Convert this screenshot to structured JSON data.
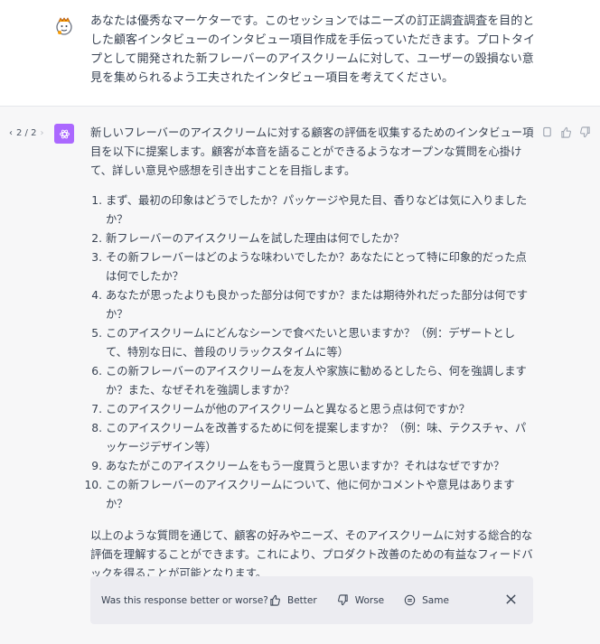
{
  "user_message": {
    "text": "あなたは優秀なマーケターです。このセッションではニーズの訂正調査調査を目的とした顧客インタビューのインタビュー項目作成を手伝っていただきます。プロトタイプとして開発された新フレーバーのアイスクリームに対して、ユーザーの毀損ない意見を集められるよう工夫されたインタビュー項目を考えてください。"
  },
  "assistant_message": {
    "pager": {
      "prev_icon": "chevron-left",
      "label": "2 / 2",
      "next_icon": "chevron-right"
    },
    "intro": "新しいフレーバーのアイスクリームに対する顧客の評価を収集するためのインタビュー項目を以下に提案します。顧客が本音を語ることができるようなオープンな質問を心掛けて、詳しい意見や感想を引き出すことを目指します。",
    "items": [
      "まず、最初の印象はどうでしたか？パッケージや見た目、香りなどは気に入りましたか？",
      "新フレーバーのアイスクリームを試した理由は何でしたか？",
      "その新フレーバーはどのような味わいでしたか？あなたにとって特に印象的だった点は何でしたか？",
      "あなたが思ったよりも良かった部分は何ですか？または期待外れだった部分は何ですか？",
      "このアイスクリームにどんなシーンで食べたいと思いますか？（例：デザートとして、特別な日に、普段のリラックスタイムに等）",
      "この新フレーバーのアイスクリームを友人や家族に勧めるとしたら、何を強調しますか？また、なぜそれを強調しますか？",
      "このアイスクリームが他のアイスクリームと異なると思う点は何ですか？",
      "このアイスクリームを改善するために何を提案しますか？（例：味、テクスチャ、パッケージデザイン等）",
      "あなたがこのアイスクリームをもう一度買うと思いますか？それはなぜですか？",
      "この新フレーバーのアイスクリームについて、他に何かコメントや意見はありますか？"
    ],
    "numbers": [
      "1.",
      "2.",
      "3.",
      "4.",
      "5.",
      "6.",
      "7.",
      "8.",
      "9.",
      "10."
    ],
    "conclusion": "以上のような質問を通じて、顧客の好みやニーズ、そのアイスクリームに対する総合的な評価を理解することができます。これにより、プロダクト改善のための有益なフィードバックを得ることが可能となります。"
  },
  "feedback": {
    "question": "Was this response better or worse?",
    "better_label": "Better",
    "worse_label": "Worse",
    "same_label": "Same"
  },
  "icons": {
    "user_avatar": "user-avatar-icon",
    "assistant_avatar": "openai-logo-icon",
    "copy": "copy-icon",
    "thumbs_up": "thumbs-up-icon",
    "thumbs_down": "thumbs-down-icon",
    "close": "close-icon"
  },
  "colors": {
    "assistant_bg": "#f7f7f8",
    "gpt_avatar": "#ab68ff",
    "feedback_bg": "#ececf1"
  }
}
